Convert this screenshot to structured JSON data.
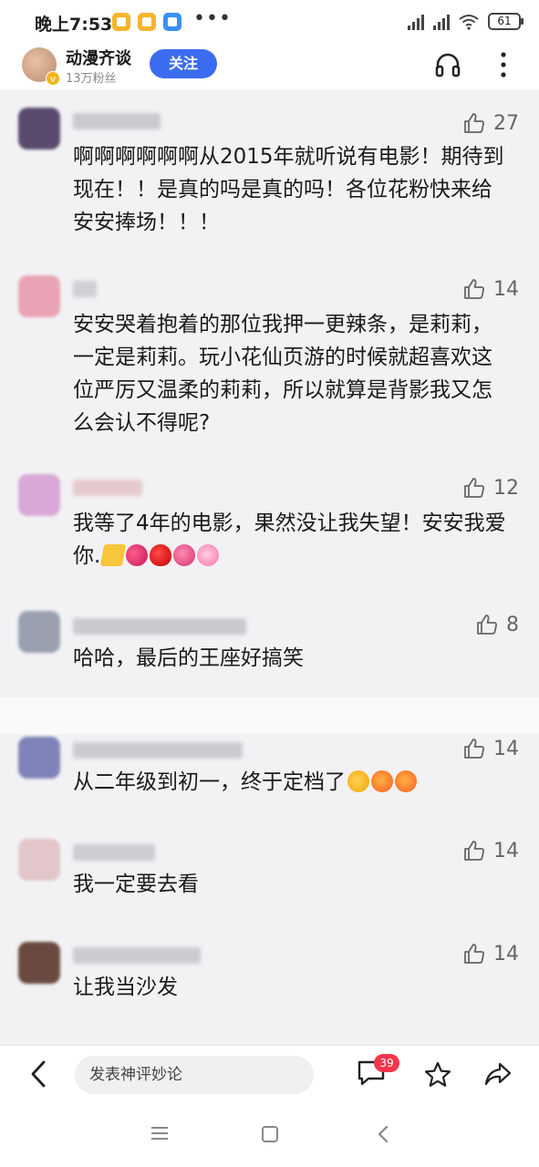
{
  "status_bar": {
    "time": "晚上7:53",
    "dots": "•••",
    "battery": "61"
  },
  "header": {
    "channel_name": "动漫齐谈",
    "fans": "13万粉丝",
    "follow_label": "关注",
    "icons": [
      "headphones-icon",
      "more-vertical-icon"
    ]
  },
  "comments": [
    {
      "likes": "27",
      "text": "啊啊啊啊啊啊从2015年就听说有电影！期待到现在！！是真的吗是真的吗！各位花粉快来给安安捧场！！！",
      "avatar_color": "#5a4a6e"
    },
    {
      "likes": "14",
      "text": "安安哭着抱着的那位我押一更辣条，是莉莉，一定是莉莉。玩小花仙页游的时候就超喜欢这位严厉又温柔的莉莉，所以就算是背影我又怎么会认不得呢?",
      "avatar_color": "#e9a3b4"
    },
    {
      "likes": "12",
      "text": "我等了4年的电影，果然没让我失望！安安我爱你.",
      "emojis": [
        "cheese-emoji",
        "two-hearts-emoji",
        "heart-emoji",
        "sparkling-heart-emoji",
        "growing-heart-emoji"
      ],
      "avatar_color": "#d9a7d6"
    },
    {
      "likes": "8",
      "text": "哈哈，最后的王座好搞笑",
      "avatar_color": "#9aa0b0"
    },
    {
      "likes": "14",
      "text": "从二年级到初一，终于定档了",
      "emojis": [
        "crying-face-emoji",
        "astonished-face-emoji",
        "astonished-face-emoji"
      ],
      "avatar_color": "#7f83b8"
    },
    {
      "likes": "14",
      "text": "我一定要去看",
      "avatar_color": "#e3c6c9"
    },
    {
      "likes": "14",
      "text": "让我当沙发",
      "avatar_color": "#6a4a40"
    }
  ],
  "bottom_bar": {
    "input_placeholder": "发表神评妙论",
    "message_count": "39"
  },
  "colors": {
    "accent": "#3c6df0",
    "badge": "#f4364c",
    "panel_bg": "#f2f2f4"
  }
}
